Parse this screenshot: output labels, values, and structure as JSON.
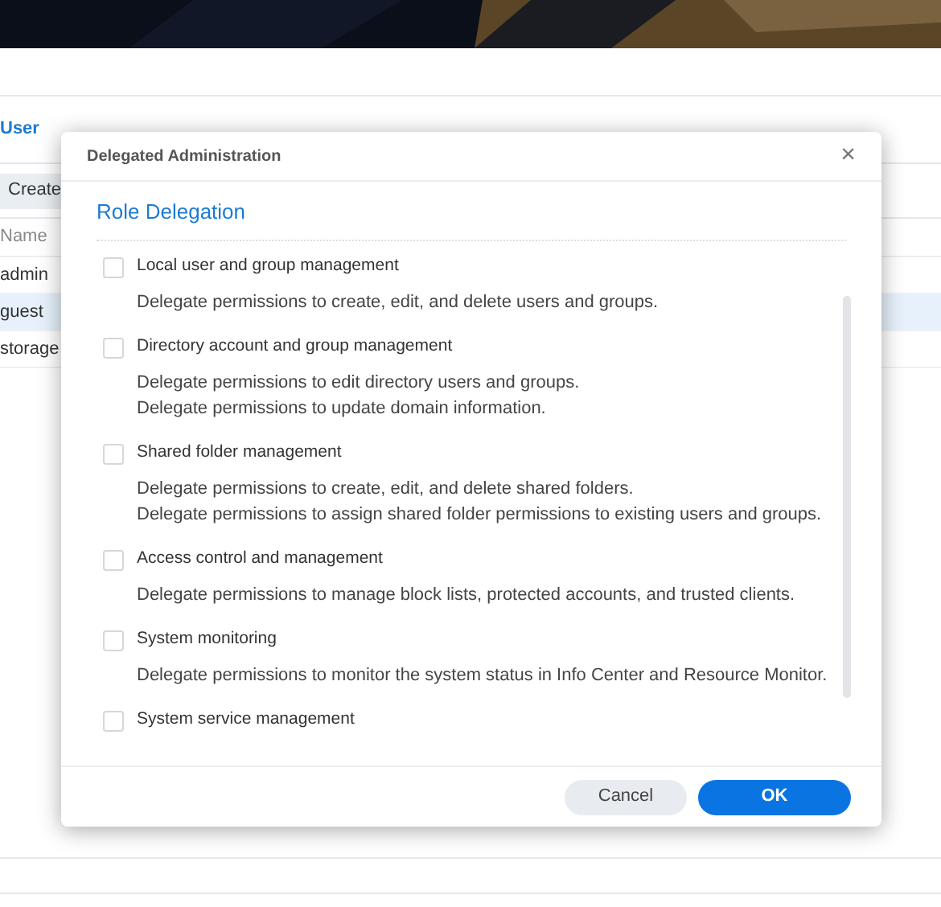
{
  "background": {
    "tabs": [
      {
        "label": "User",
        "selected": true
      }
    ],
    "toolbar": {
      "create_button": "Create"
    },
    "table": {
      "columns": [
        "Name"
      ],
      "rows": [
        {
          "name": "admin",
          "selected": false
        },
        {
          "name": "guest",
          "selected": true
        },
        {
          "name": "storage",
          "selected": false
        }
      ]
    }
  },
  "dialog": {
    "title": "Delegated Administration",
    "close": "×",
    "section": "Role Delegation",
    "roles": [
      {
        "label": "Local user and group management",
        "checked": false,
        "descriptions": [
          "Delegate permissions to create, edit, and delete users and groups."
        ]
      },
      {
        "label": "Directory account and group management",
        "checked": false,
        "descriptions": [
          "Delegate permissions to edit directory users and groups.",
          "Delegate permissions to update domain information."
        ]
      },
      {
        "label": "Shared folder management",
        "checked": false,
        "descriptions": [
          "Delegate permissions to create, edit, and delete shared folders.",
          "Delegate permissions to assign shared folder permissions to existing users and groups."
        ]
      },
      {
        "label": "Access control and management",
        "checked": false,
        "descriptions": [
          "Delegate permissions to manage block lists, protected accounts, and trusted clients."
        ]
      },
      {
        "label": "System monitoring",
        "checked": false,
        "descriptions": [
          "Delegate permissions to monitor the system status in Info Center and Resource Monitor."
        ]
      },
      {
        "label": "System service management",
        "checked": false
      }
    ],
    "buttons": [
      {
        "label": "Cancel",
        "kind": "secondary"
      },
      {
        "label": "OK",
        "kind": "primary"
      }
    ]
  }
}
